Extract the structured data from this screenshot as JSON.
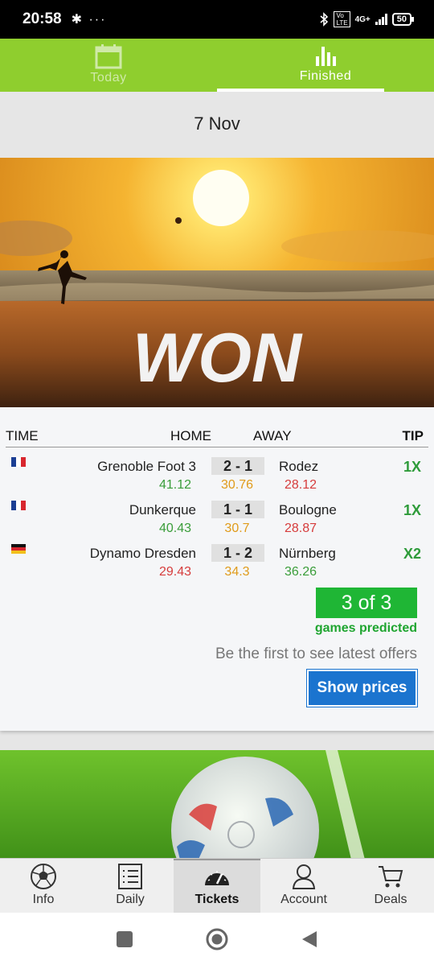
{
  "status_bar": {
    "time": "20:58",
    "left_icons": "✱ ···",
    "network": "4G+",
    "battery": "50"
  },
  "tabs": [
    {
      "label": "Today",
      "icon": "calendar-icon",
      "active": false
    },
    {
      "label": "Finished",
      "icon": "bar-chart-icon",
      "active": true
    }
  ],
  "date": "7 Nov",
  "hero": {
    "text": "WON"
  },
  "table": {
    "headers": {
      "time": "TIME",
      "home": "HOME",
      "away": "AWAY",
      "tip": "TIP"
    },
    "rows": [
      {
        "flag": "france",
        "home": "Grenoble Foot 3",
        "score": "2 - 1",
        "away": "Rodez",
        "tip": "1X",
        "odd1": "41.12",
        "oddx": "30.76",
        "odd2": "28.12",
        "odd1_color": "green",
        "odd2_color": "red"
      },
      {
        "flag": "france",
        "home": "Dunkerque",
        "score": "1 - 1",
        "away": "Boulogne",
        "tip": "1X",
        "odd1": "40.43",
        "oddx": "30.7",
        "odd2": "28.87",
        "odd1_color": "green",
        "odd2_color": "red"
      },
      {
        "flag": "germany",
        "home": "Dynamo Dresden",
        "score": "1 - 2",
        "away": "Nürnberg",
        "tip": "X2",
        "odd1": "29.43",
        "oddx": "34.3",
        "odd2": "36.26",
        "odd1_color": "red",
        "odd2_color": "green"
      }
    ]
  },
  "predicted": {
    "count": "3 of 3",
    "label": "games predicted"
  },
  "offers_text": "Be the first to see latest offers",
  "show_prices": "Show prices",
  "bottom_nav": [
    {
      "label": "Info",
      "icon": "soccer-ball-icon",
      "active": false
    },
    {
      "label": "Daily",
      "icon": "list-icon",
      "active": false
    },
    {
      "label": "Tickets",
      "icon": "speedometer-icon",
      "active": true
    },
    {
      "label": "Account",
      "icon": "user-icon",
      "active": false
    },
    {
      "label": "Deals",
      "icon": "cart-icon",
      "active": false
    }
  ],
  "colors": {
    "brand_green": "#8fce2e",
    "button_blue": "#1b74cf",
    "predicted_green": "#1fb635"
  }
}
